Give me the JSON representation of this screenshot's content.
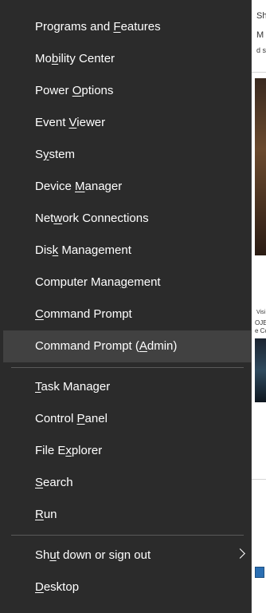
{
  "background_window": {
    "snippet_top": "Sh",
    "snippet_second": "M",
    "snippet_third": "d se",
    "snippet_mid": "Visi",
    "snippet_mid2": "OJECT",
    "snippet_mid3": "e Co"
  },
  "menu": {
    "items": [
      {
        "label_pre": "Programs and ",
        "label_key": "F",
        "label_post": "eatures"
      },
      {
        "label_pre": "Mo",
        "label_key": "b",
        "label_post": "ility Center"
      },
      {
        "label_pre": "Power ",
        "label_key": "O",
        "label_post": "ptions"
      },
      {
        "label_pre": "Event ",
        "label_key": "V",
        "label_post": "iewer"
      },
      {
        "label_pre": "S",
        "label_key": "y",
        "label_post": "stem"
      },
      {
        "label_pre": "Device ",
        "label_key": "M",
        "label_post": "anager"
      },
      {
        "label_pre": "Net",
        "label_key": "w",
        "label_post": "ork Connections"
      },
      {
        "label_pre": "Dis",
        "label_key": "k",
        "label_post": " Management"
      },
      {
        "label_pre": "Computer Mana",
        "label_key": "g",
        "label_post": "ement"
      },
      {
        "label_pre": "",
        "label_key": "C",
        "label_post": "ommand Prompt"
      },
      {
        "label_pre": "Command Prompt (",
        "label_key": "A",
        "label_post": "dmin)"
      },
      {
        "label_pre": "",
        "label_key": "T",
        "label_post": "ask Manager"
      },
      {
        "label_pre": "Control ",
        "label_key": "P",
        "label_post": "anel"
      },
      {
        "label_pre": "File E",
        "label_key": "x",
        "label_post": "plorer"
      },
      {
        "label_pre": "",
        "label_key": "S",
        "label_post": "earch"
      },
      {
        "label_pre": "",
        "label_key": "R",
        "label_post": "un"
      },
      {
        "label_pre": "Sh",
        "label_key": "u",
        "label_post": "t down or sign out"
      },
      {
        "label_pre": "",
        "label_key": "D",
        "label_post": "esktop"
      }
    ],
    "hovered_item": "Command Prompt (Admin)",
    "submenu_indicator": "chevron-right-icon"
  },
  "colors": {
    "menu_background": "#2b2b2b",
    "hover_background": "#414141",
    "separator": "#5a5a5a",
    "text": "#ffffff"
  }
}
